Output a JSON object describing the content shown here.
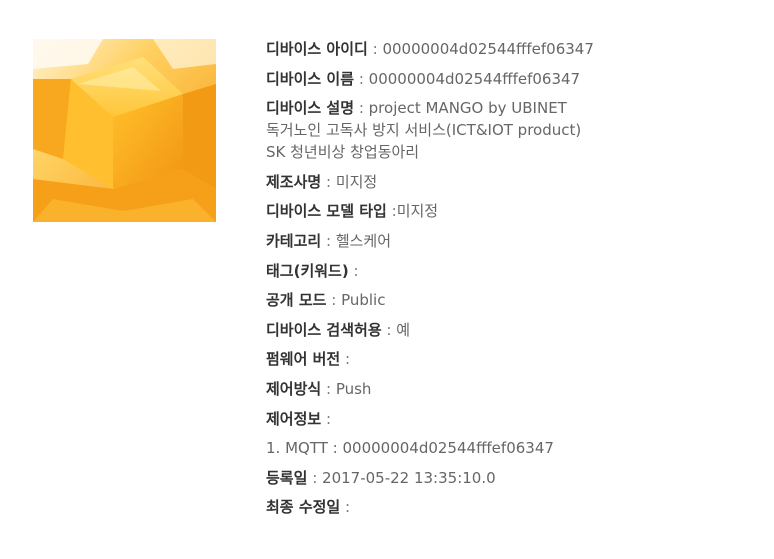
{
  "image": {
    "alt": "mango cubes",
    "icon": "mango-photo"
  },
  "colors": {
    "label": "#333333",
    "value": "#666666",
    "mango_light": "#ffd96a",
    "mango_dark": "#f7a21a"
  },
  "fields": {
    "device_id": {
      "label": "디바이스 아이디",
      "value": "00000004d02544fffef06347"
    },
    "device_name": {
      "label": "디바이스 이름",
      "value": "00000004d02544fffef06347"
    },
    "device_desc": {
      "label": "디바이스 설명",
      "value_line1": "project MANGO by UBINET",
      "value_line2": "독거노인 고독사 방지 서비스(ICT&IOT product)",
      "value_line3": "SK 청년비상 창업동아리"
    },
    "manufacturer": {
      "label": "제조사명",
      "value": "미지정"
    },
    "model_type": {
      "label": "디바이스 모델 타입",
      "value": "미지정"
    },
    "category": {
      "label": "카테고리",
      "value": "헬스케어"
    },
    "tags": {
      "label": "태그(키워드)",
      "value": ""
    },
    "public_mode": {
      "label": "공개 모드",
      "value": "Public"
    },
    "search_allowed": {
      "label": "디바이스 검색허용",
      "value": "예"
    },
    "firmware": {
      "label": "펌웨어 버전",
      "value": ""
    },
    "control_method": {
      "label": "제어방식",
      "value": "Push"
    },
    "control_info": {
      "label": "제어정보",
      "value": ""
    },
    "control_item": {
      "text": "1. MQTT : 00000004d02544fffef06347"
    },
    "registered": {
      "label": "등록일",
      "value": "2017-05-22 13:35:10.0"
    },
    "last_modified": {
      "label": "최종 수정일",
      "value": ""
    }
  },
  "separator": ":"
}
